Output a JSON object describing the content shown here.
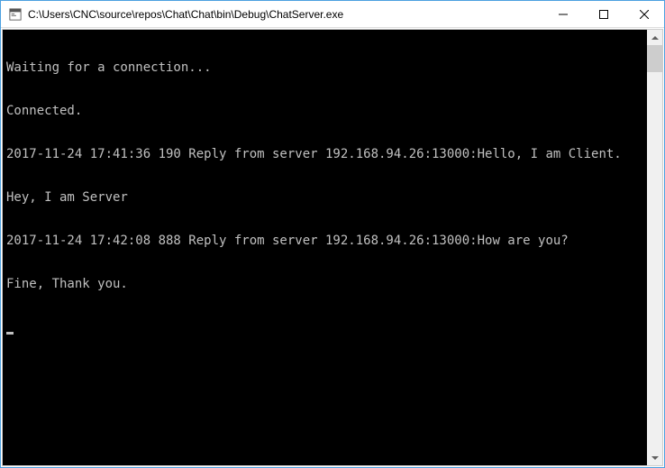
{
  "window": {
    "title": " C:\\Users\\CNC\\source\\repos\\Chat\\Chat\\bin\\Debug\\ChatServer.exe"
  },
  "console": {
    "lines": [
      "Waiting for a connection...",
      "Connected.",
      "2017-11-24 17:41:36 190 Reply from server 192.168.94.26:13000:Hello, I am Client.",
      "Hey, I am Server",
      "2017-11-24 17:42:08 888 Reply from server 192.168.94.26:13000:How are you?",
      "Fine, Thank you."
    ]
  }
}
